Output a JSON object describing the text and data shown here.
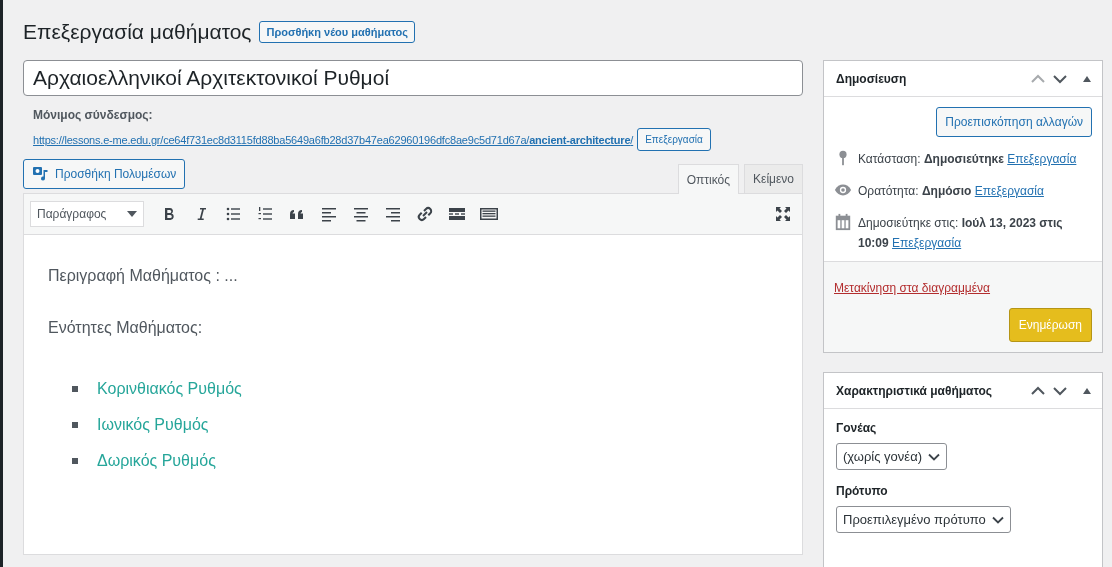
{
  "page_title": "Επεξεργασία μαθήματος",
  "add_new_button": "Προσθήκη νέου μαθήματος",
  "post_title": {
    "value": "Αρχαιοελληνικοί Αρχιτεκτονικοί Ρυθμοί"
  },
  "permalink": {
    "label": "Μόνιμος σύνδεσμος:",
    "url": "https://lessons.e-me.edu.gr/ce64f731ec8d3115fd88ba5649a6fb28d37b47ea62960196dfc8ae9c5d71d67a/**ancient-architecture**/",
    "edit_button": "Επεξεργασία"
  },
  "add_media_button": "Προσθήκη Πολυμέσων",
  "editor_tabs": [
    {
      "label": "Οπτικός",
      "selected": true
    },
    {
      "label": "Κείμενο",
      "selected": false
    }
  ],
  "toolbar": {
    "format_select": "Παράγραφος",
    "tools": [
      {
        "kind": "bold"
      },
      {
        "kind": "italic"
      },
      {
        "kind": "bullet-list"
      },
      {
        "kind": "numbered-list"
      },
      {
        "kind": "quote"
      },
      {
        "kind": "align-left"
      },
      {
        "kind": "align-center"
      },
      {
        "kind": "align-right"
      },
      {
        "kind": "link"
      },
      {
        "kind": "more"
      },
      {
        "kind": "toolbar-toggle"
      }
    ]
  },
  "content": [
    {
      "kind": "paragraph",
      "text": "Περιγραφή Μαθήματος : ..."
    },
    {
      "kind": "paragraph",
      "text": "Ενότητες Μαθήματος:"
    },
    {
      "kind": "list",
      "items": [
        "Κορινθιακός Ρυθμός",
        "Ιωνικός Ρυθμός",
        "Δωρικός Ρυθμός"
      ]
    }
  ],
  "publish_box": {
    "title": "Δημοσίευση",
    "preview_button": "Προεπισκόπηση αλλαγών",
    "rows": [
      {
        "kind": "status",
        "text": "Κατάσταση: **Δημοσιεύτηκε**",
        "link": "Επεξεργασία"
      },
      {
        "kind": "visibility",
        "text": "Ορατότητα: **Δημόσιο**",
        "link": "Επεξεργασία"
      },
      {
        "kind": "date",
        "text": "Δημοσιεύτηκε στις: **Ιούλ 13, 2023 στις 10:09**",
        "link": "Επεξεργασία"
      }
    ],
    "trash_link": "Μετακίνηση στα διαγραμμένα",
    "update_button": "Ενημέρωση"
  },
  "attributes_box": {
    "title": "Χαρακτηριστικά μαθήματος",
    "fields": [
      {
        "label": "Γονέας",
        "value": "(χωρίς γονέα)"
      },
      {
        "label": "Πρότυπο",
        "value": "Προεπιλεγμένο πρότυπο"
      }
    ]
  }
}
